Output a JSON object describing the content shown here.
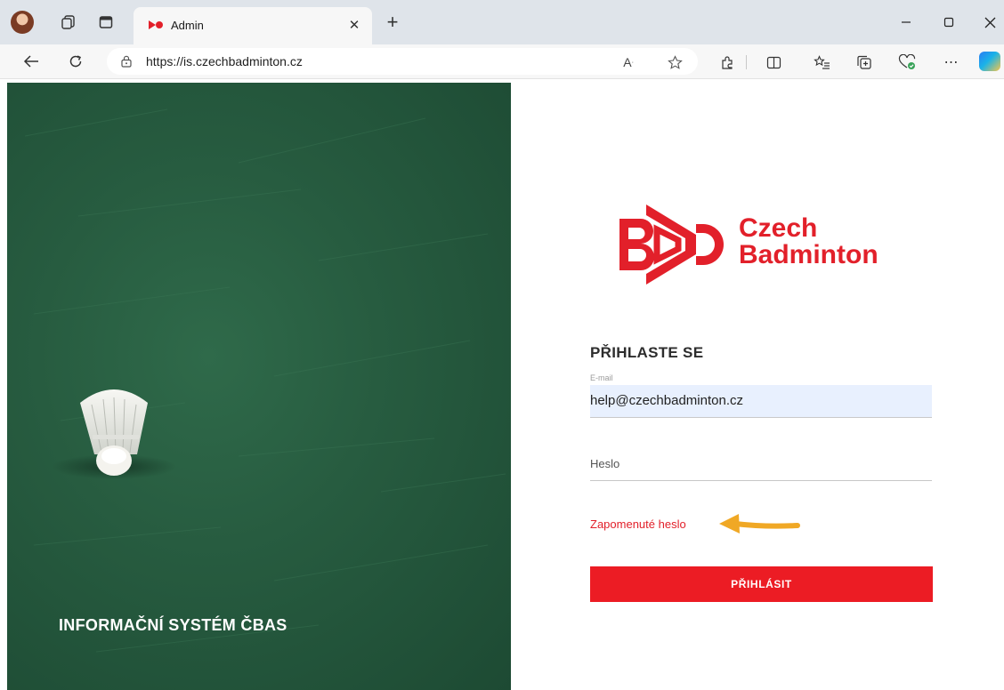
{
  "browser": {
    "tab_title": "Admin",
    "url": "https://is.czechbadminton.cz"
  },
  "hero": {
    "title": "INFORMAČNÍ SYSTÉM ČBAS"
  },
  "logo": {
    "line1": "Czech",
    "line2": "Badminton"
  },
  "login": {
    "heading": "PŘIHLASTE SE",
    "email_label": "E-mail",
    "email_value": "help@czechbadminton.cz",
    "password_placeholder": "Heslo",
    "forgot_password": "Zapomenuté heslo",
    "submit_label": "PŘIHLÁSIT"
  },
  "colors": {
    "brand_red": "#e2202a",
    "hero_green": "#275c40",
    "email_autofill_bg": "#e8f0fe",
    "arrow": "#f0a825"
  }
}
